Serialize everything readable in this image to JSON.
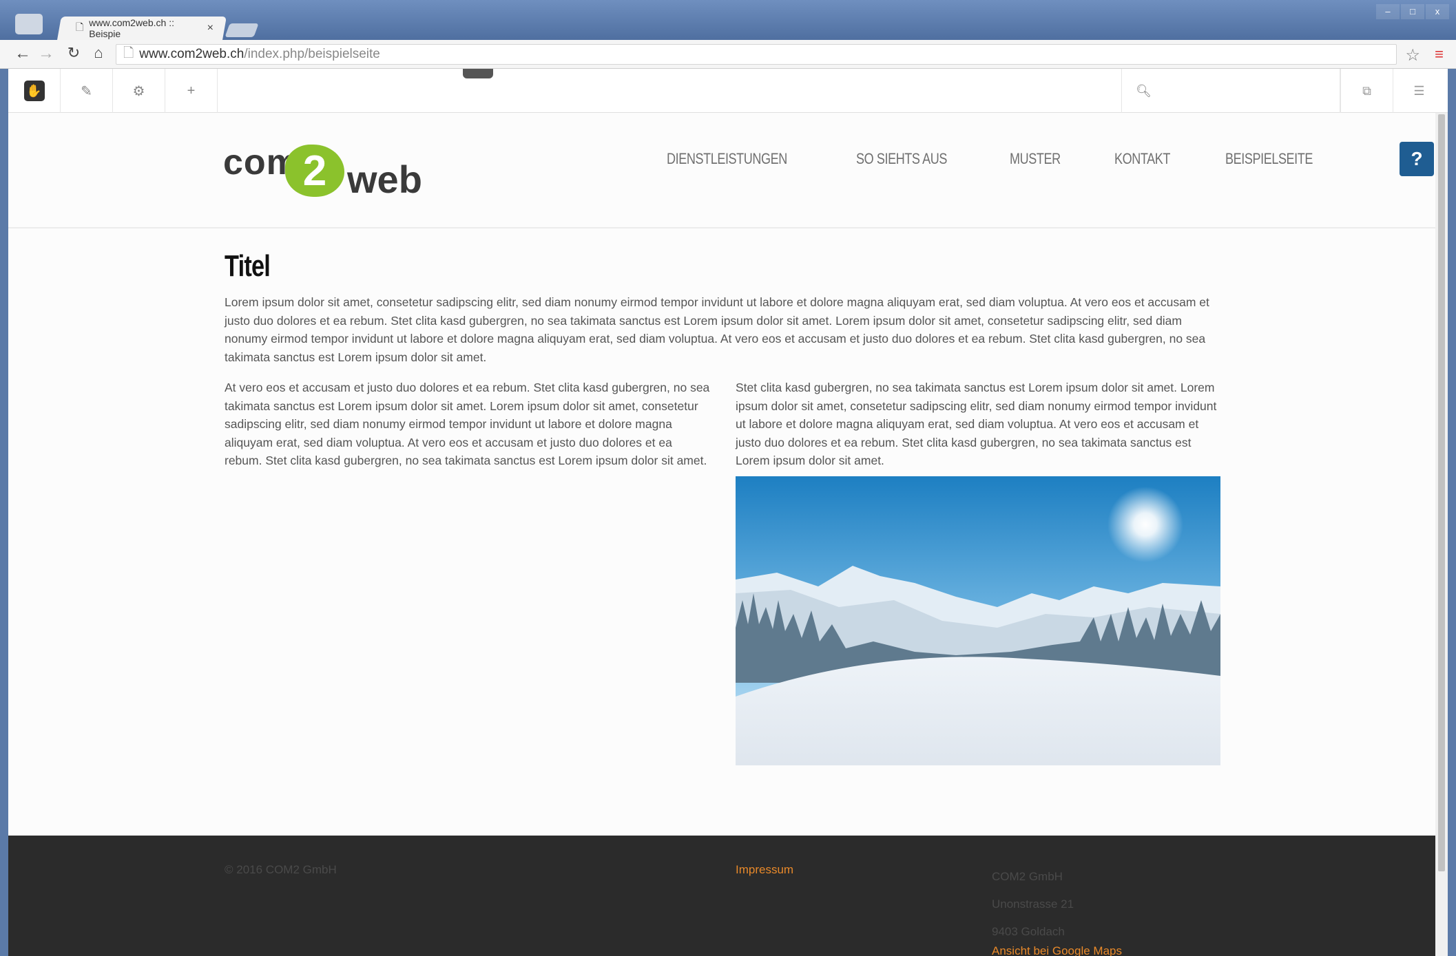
{
  "browser": {
    "tab_title": "www.com2web.ch :: Beispie",
    "tab_close": "×",
    "url_domain": "www.com2web.ch",
    "url_path": "/index.php/beispielseite",
    "window_controls": [
      "–",
      "□",
      "x"
    ]
  },
  "cms_toolbar": {
    "icons": [
      "cms-logo-icon",
      "pencil-icon",
      "gear-icon",
      "plus-icon",
      "search-icon",
      "copy-icon",
      "sliders-icon"
    ]
  },
  "site": {
    "logo": {
      "part1": "com",
      "part2": "2",
      "part3": "web"
    },
    "nav": [
      "DIENSTLEISTUNGEN",
      "SO SIEHTS AUS",
      "MUSTER",
      "KONTAKT",
      "BEISPIELSEITE"
    ],
    "help_label": "?"
  },
  "content": {
    "title": "Titel",
    "intro": "Lorem ipsum dolor sit amet, consetetur sadipscing elitr, sed diam nonumy eirmod tempor invidunt ut labore et dolore magna aliquyam erat, sed diam voluptua. At vero eos et accusam et justo duo dolores et ea rebum. Stet clita kasd gubergren, no sea takimata sanctus est Lorem ipsum dolor sit amet. Lorem ipsum dolor sit amet, consetetur sadipscing elitr, sed diam nonumy eirmod tempor invidunt ut labore et dolore magna aliquyam erat, sed diam voluptua. At vero eos et accusam et justo duo dolores et ea rebum. Stet clita kasd gubergren, no sea takimata sanctus est Lorem ipsum dolor sit amet.",
    "col_left": "At vero eos et accusam et justo duo dolores et ea rebum. Stet clita kasd gubergren, no sea takimata sanctus est Lorem ipsum dolor sit amet. Lorem ipsum dolor sit amet, consetetur sadipscing elitr, sed diam nonumy eirmod tempor invidunt ut labore et dolore magna aliquyam erat, sed diam voluptua. At vero eos et accusam et justo duo dolores et ea rebum. Stet clita kasd gubergren, no sea takimata sanctus est Lorem ipsum dolor sit amet.",
    "col_right": "Stet clita kasd gubergren, no sea takimata sanctus est Lorem ipsum dolor sit amet. Lorem ipsum dolor sit amet, consetetur sadipscing elitr, sed diam nonumy eirmod tempor invidunt ut labore et dolore magna aliquyam erat, sed diam voluptua. At vero eos et accusam et justo duo dolores et ea rebum. Stet clita kasd gubergren, no sea takimata sanctus est Lorem ipsum dolor sit amet."
  },
  "footer": {
    "copyright": "© 2016 COM2 GmbH",
    "impressum": "Impressum",
    "company": "COM2 GmbH",
    "street": "Unonstrasse 21",
    "city": "9403 Goldach",
    "maps_link": "Ansicht bei Google Maps"
  },
  "colors": {
    "brand_green": "#8bc22c",
    "link_orange": "#e8892a",
    "help_blue": "#1f5d92",
    "footer_bg": "#2b2b2b"
  }
}
